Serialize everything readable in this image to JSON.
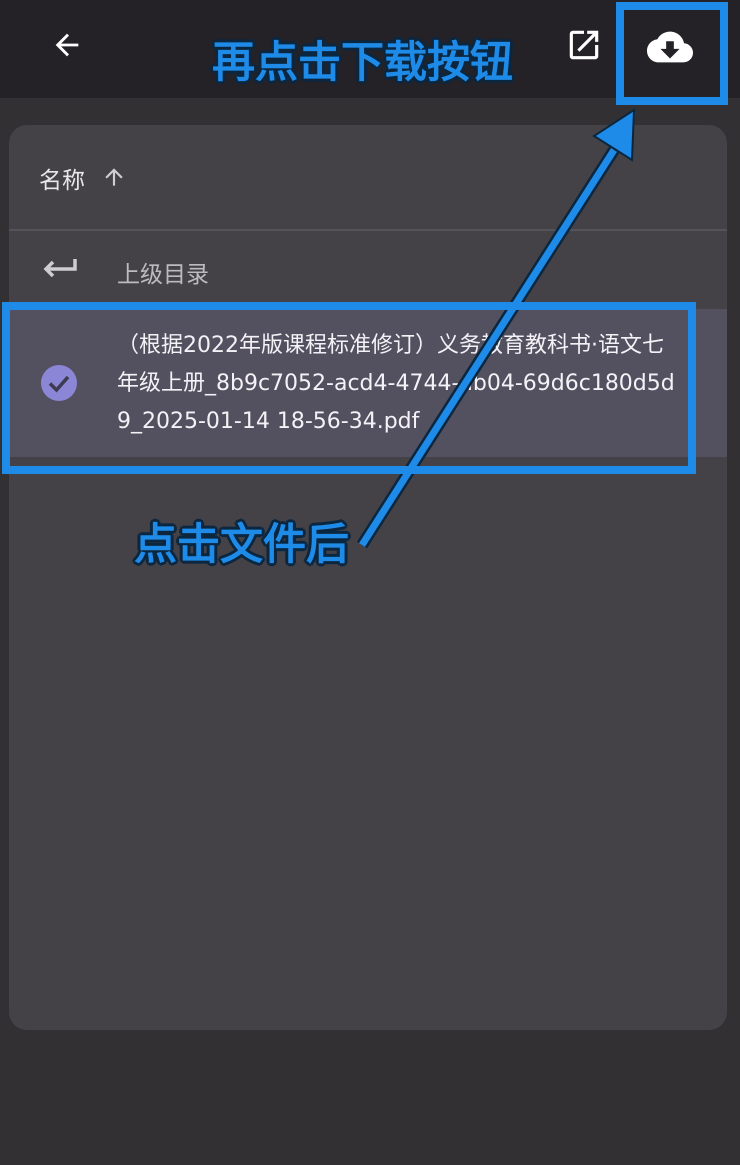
{
  "toolbar": {
    "back_icon": "arrow-left-icon",
    "open_icon": "open-external-icon",
    "download_icon": "cloud-download-icon"
  },
  "list": {
    "header_label": "名称",
    "sort_icon": "arrow-up-icon",
    "parent_label": "上级目录",
    "parent_icon": "return-arrow-icon",
    "files": [
      {
        "name": "（根据2022年版课程标准修订）义务教育教科书·语文七年级上册_8b9c7052-acd4-4744-ab04-69d6c180d5d9_2025-01-14 18-56-34.pdf",
        "selected": true,
        "icon": "check-circle-icon"
      }
    ]
  },
  "annotations": {
    "download_hint": "再点击下载按钮",
    "file_hint": "点击文件后",
    "color": "#1f8be8"
  },
  "colors": {
    "topbar": "#242226",
    "background": "#323033",
    "panel": "#444246",
    "selected_row": "#535160",
    "check": "#8b87d6"
  }
}
